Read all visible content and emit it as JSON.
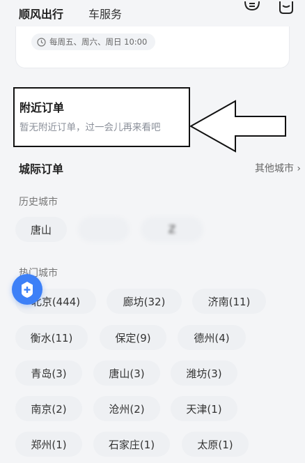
{
  "tabs": {
    "active_label": "顺风出行",
    "inactive_label": "车服务"
  },
  "schedule": {
    "text": "每周五、周六、周日 10:00"
  },
  "nearby": {
    "title": "附近订单",
    "empty_text": "暂无附近订单，过一会儿再来看吧"
  },
  "intercity": {
    "title": "城际订单",
    "other_cities_label": "其他城市",
    "history_title": "历史城市",
    "history_cities": [
      "唐山",
      "",
      "Z"
    ],
    "hot_title": "热门城市",
    "hot_cities": [
      "北京(444)",
      "廊坊(32)",
      "济南(11)",
      "衡水(11)",
      "保定(9)",
      "德州(4)",
      "青岛(3)",
      "唐山(3)",
      "潍坊(3)",
      "南京(2)",
      "沧州(2)",
      "天津(1)",
      "郑州(1)",
      "石家庄(1)",
      "太原(1)"
    ]
  },
  "colors": {
    "accent": "#2d7cf6",
    "chip_bg": "#eef0f3",
    "page_bg": "#f4f5f7"
  },
  "icons": [
    "clock-icon",
    "message-icon",
    "mailbox-icon",
    "plus-icon",
    "arrow-annotation-icon"
  ]
}
